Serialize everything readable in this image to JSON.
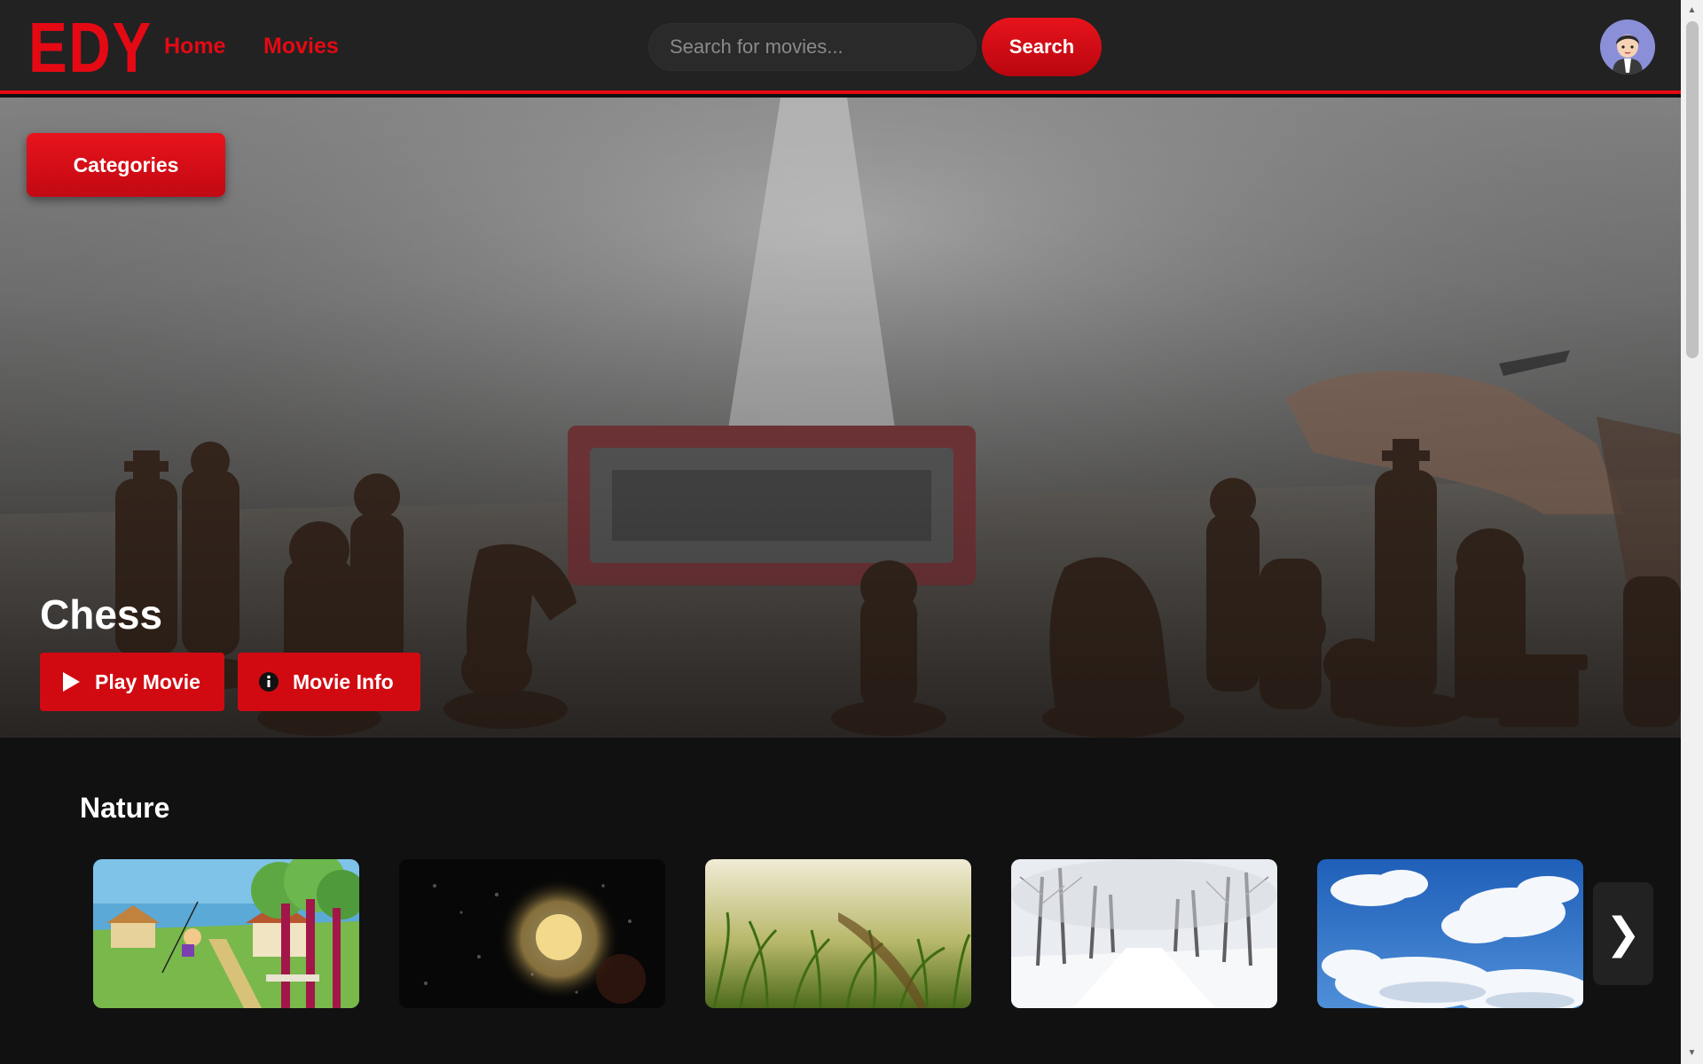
{
  "header": {
    "logo": "EDY",
    "nav": {
      "home": "Home",
      "movies": "Movies"
    },
    "search": {
      "placeholder": "Search for movies...",
      "value": "",
      "button": "Search"
    },
    "avatar_icon": "user-avatar-icon"
  },
  "hero": {
    "categories_button": "Categories",
    "title": "Chess",
    "play_button": "Play Movie",
    "info_button": "Movie Info",
    "play_icon": "play-icon",
    "info_icon": "info-icon"
  },
  "rows": [
    {
      "title": "Nature",
      "items": [
        {
          "thumbnail": "cartoon-park-scene"
        },
        {
          "thumbnail": "rain-on-window-night"
        },
        {
          "thumbnail": "grass-closeup"
        },
        {
          "thumbnail": "snowy-forest-road"
        },
        {
          "thumbnail": "blue-sky-clouds"
        }
      ],
      "next_icon": "chevron-right-icon",
      "next_glyph": "❯"
    }
  ],
  "colors": {
    "accent": "#e50914",
    "header_bg": "#222222",
    "page_bg": "#111111"
  }
}
